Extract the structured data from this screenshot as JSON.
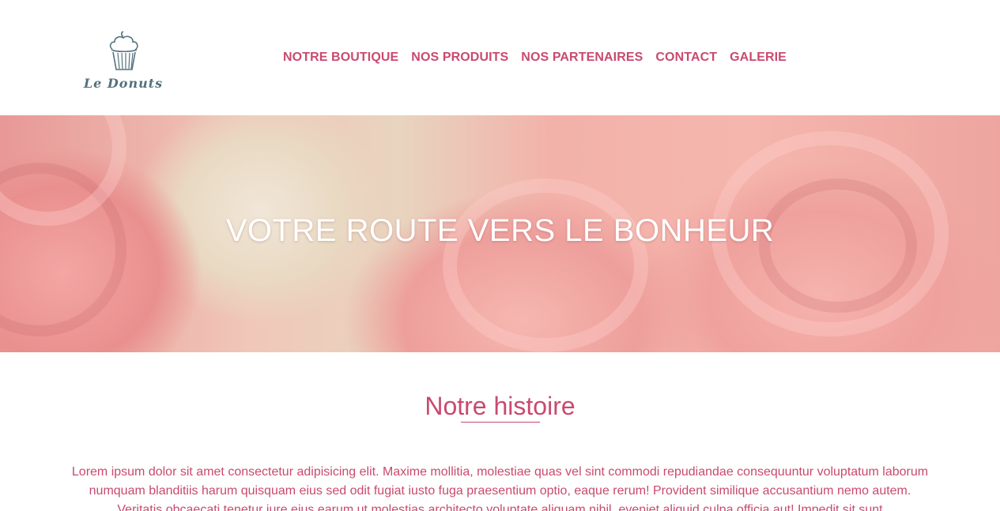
{
  "brand": {
    "name": "Le Donuts",
    "logo_icon": "cupcake-icon"
  },
  "nav": {
    "items": [
      {
        "label": "NOTRE BOUTIQUE"
      },
      {
        "label": "NOS PRODUITS"
      },
      {
        "label": "NOS PARTENAIRES"
      },
      {
        "label": "CONTACT"
      },
      {
        "label": "GALERIE"
      }
    ]
  },
  "hero": {
    "title": "VOTRE ROUTE VERS LE BONHEUR"
  },
  "story": {
    "title": "Notre histoire",
    "text": "Lorem ipsum dolor sit amet consectetur adipisicing elit. Maxime mollitia, molestiae quas vel sint commodi repudiandae consequuntur voluptatum laborum numquam blanditiis harum quisquam eius sed odit fugiat iusto fuga praesentium optio, eaque rerum! Provident similique accusantium nemo autem. Veritatis obcaecati tenetur iure eius earum ut molestias architecto voluptate aliquam nihil, eveniet aliquid culpa officia aut! Impedit sit sunt"
  },
  "colors": {
    "accent": "#c94a6e",
    "logo": "#54707e",
    "hero_text": "#ffffff"
  }
}
